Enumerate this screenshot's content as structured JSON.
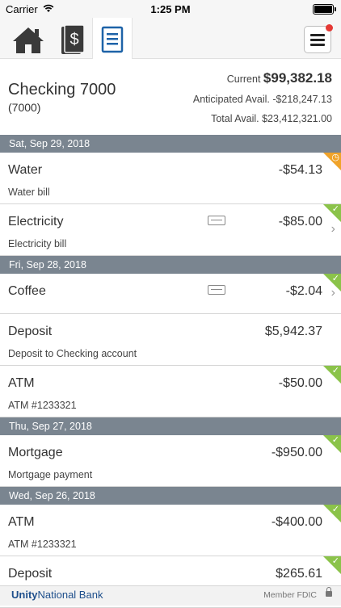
{
  "status_bar": {
    "carrier": "Carrier",
    "time": "1:25 PM"
  },
  "toolbar": {
    "icons": [
      "home-icon",
      "money-icon",
      "register-icon",
      "menu-icon"
    ],
    "active": "register-icon",
    "notification_color": "#e53935"
  },
  "account": {
    "name": "Checking 7000",
    "number": "(7000)",
    "current_label": "Current",
    "current_value": "$99,382.18",
    "anticipated": "Anticipated Avail. -$218,247.13",
    "total": "Total Avail. $23,412,321.00"
  },
  "groups": [
    {
      "date": "Sat, Sep 29, 2018",
      "items": [
        {
          "name": "Water",
          "desc": "Water bill",
          "amount": "-$54.13",
          "status": "pending"
        },
        {
          "name": "Electricity",
          "desc": "Electricity bill",
          "amount": "-$85.00",
          "status": "cleared",
          "memo": true,
          "chevron": true
        }
      ]
    },
    {
      "date": "Fri, Sep 28, 2018",
      "items": [
        {
          "name": "Coffee",
          "desc": "",
          "amount": "-$2.04",
          "status": "cleared",
          "memo": true,
          "chevron": true
        },
        {
          "name": "Deposit",
          "desc": "Deposit to Checking account",
          "amount": "$5,942.37",
          "status": "cleared"
        },
        {
          "name": "ATM",
          "desc": "ATM #1233321",
          "amount": "-$50.00",
          "status": "cleared"
        }
      ]
    },
    {
      "date": "Thu, Sep 27, 2018",
      "items": [
        {
          "name": "Mortgage",
          "desc": "Mortgage payment",
          "amount": "-$950.00",
          "status": "cleared"
        }
      ]
    },
    {
      "date": "Wed, Sep 26, 2018",
      "items": [
        {
          "name": "ATM",
          "desc": "ATM #1233321",
          "amount": "-$400.00",
          "status": "cleared"
        },
        {
          "name": "Deposit",
          "desc": "",
          "amount": "$265.61",
          "status": "cleared"
        }
      ]
    }
  ],
  "colors": {
    "cleared": "#8bc34a",
    "pending": "#f0a32a",
    "date_header": "#7a8590"
  },
  "footer": {
    "bank_bold": "Unity",
    "bank_rest": "National Bank",
    "fdic": "Member FDIC"
  }
}
